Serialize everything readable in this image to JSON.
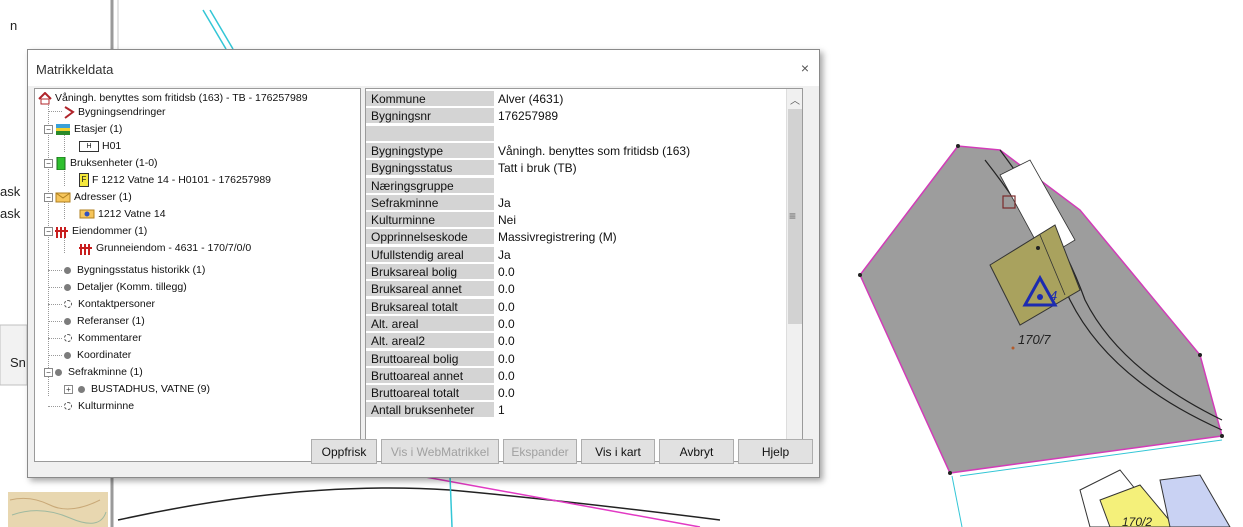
{
  "background": {
    "fragments": [
      "n",
      "ask",
      "ask",
      "Sn"
    ],
    "parcel_label": "170/7",
    "map_marker_label": "4",
    "map_marker_label_2": "170/2"
  },
  "dialog": {
    "title": "Matrikkeldata",
    "close_glyph": "×",
    "tree": [
      {
        "label": "Våningh. benyttes som fritidsb (163) - TB - 176257989",
        "icon": "house-icon"
      },
      {
        "label": "Bygningsendringer",
        "icon": "arrow-icon"
      },
      {
        "label": "Etasjer (1)",
        "icon": "floors-icon"
      },
      {
        "label": "H01",
        "icon": "floor-label-icon"
      },
      {
        "label": "Bruksenheter (1-0)",
        "icon": "unit-icon"
      },
      {
        "label": "F 1212 Vatne 14 - H0101 - 176257989",
        "icon": "unit-f-icon"
      },
      {
        "label": "Adresser (1)",
        "icon": "envelope-icon"
      },
      {
        "label": "1212 Vatne 14",
        "icon": "address-icon"
      },
      {
        "label": "Eiendommer (1)",
        "icon": "property-icon"
      },
      {
        "label": "Grunneiendom - 4631 - 170/7/0/0",
        "icon": "property-icon"
      },
      {
        "label": "Bygningsstatus historikk (1)",
        "icon": "dot-icon"
      },
      {
        "label": "Detaljer (Komm. tillegg)",
        "icon": "dot-icon"
      },
      {
        "label": "Kontaktpersoner",
        "icon": "ring-icon"
      },
      {
        "label": "Referanser (1)",
        "icon": "dot-icon"
      },
      {
        "label": "Kommentarer",
        "icon": "ring-icon"
      },
      {
        "label": "Koordinater",
        "icon": "dot-icon"
      },
      {
        "label": "Sefrakminne (1)",
        "icon": "dot-icon"
      },
      {
        "label": "BUSTADHUS, VATNE (9)",
        "icon": "dot-icon"
      },
      {
        "label": "Kulturminne",
        "icon": "ring-icon"
      }
    ],
    "tree_expander_minus": "−",
    "tree_expander_plus": "+",
    "floor_badge": "H",
    "unit_badge": "F",
    "properties": [
      {
        "key": "Kommune",
        "value": "Alver (4631)"
      },
      {
        "key": "Bygningsnr",
        "value": "176257989"
      },
      {
        "key": "",
        "value": ""
      },
      {
        "key": "Bygningstype",
        "value": "Våningh. benyttes som fritidsb (163)"
      },
      {
        "key": "Bygningsstatus",
        "value": "Tatt i bruk (TB)"
      },
      {
        "key": "Næringsgruppe",
        "value": ""
      },
      {
        "key": "Sefrakminne",
        "value": "Ja"
      },
      {
        "key": "Kulturminne",
        "value": "Nei"
      },
      {
        "key": "Opprinnelseskode",
        "value": "Massivregistrering (M)"
      },
      {
        "key": "Ufullstendig areal",
        "value": "Ja"
      },
      {
        "key": "Bruksareal bolig",
        "value": "0.0"
      },
      {
        "key": "Bruksareal annet",
        "value": "0.0"
      },
      {
        "key": "Bruksareal totalt",
        "value": "0.0"
      },
      {
        "key": "Alt. areal",
        "value": "0.0"
      },
      {
        "key": "Alt. areal2",
        "value": "0.0"
      },
      {
        "key": "Bruttoareal bolig",
        "value": "0.0"
      },
      {
        "key": "Bruttoareal annet",
        "value": "0.0"
      },
      {
        "key": "Bruttoareal totalt",
        "value": "0.0"
      },
      {
        "key": "Antall bruksenheter",
        "value": "1"
      }
    ],
    "scroll": {
      "up": "︿",
      "down": "﹀",
      "grip": "≡"
    },
    "buttons": [
      {
        "label": "Oppfrisk",
        "enabled": true
      },
      {
        "label": "Vis i WebMatrikkel",
        "enabled": false
      },
      {
        "label": "Ekspander",
        "enabled": false
      },
      {
        "label": "Vis i kart",
        "enabled": true
      },
      {
        "label": "Avbryt",
        "enabled": true
      },
      {
        "label": "Hjelp",
        "enabled": true
      }
    ]
  }
}
